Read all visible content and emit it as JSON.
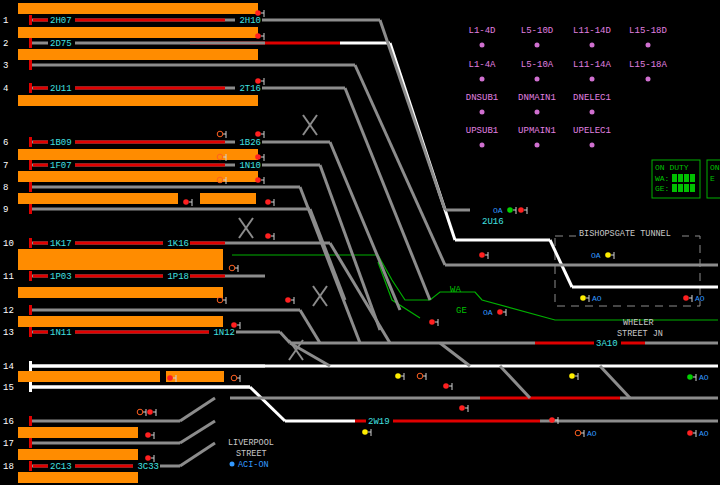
{
  "platforms": [
    {
      "number": "1",
      "track": "occupied",
      "berths": [
        "2H07",
        "2H10"
      ]
    },
    {
      "number": "2",
      "track": "clear",
      "berths": [
        "2D75"
      ]
    },
    {
      "number": "3",
      "track": "clear",
      "berths": []
    },
    {
      "number": "4",
      "track": "occupied",
      "berths": [
        "2U11",
        "2T16"
      ]
    },
    {
      "number": "6",
      "track": "occupied",
      "berths": [
        "1B09",
        "1B26"
      ]
    },
    {
      "number": "7",
      "track": "occupied",
      "berths": [
        "1F07",
        "1N10"
      ]
    },
    {
      "number": "8",
      "track": "clear",
      "berths": []
    },
    {
      "number": "9",
      "track": "clear",
      "berths": []
    },
    {
      "number": "10",
      "track": "occupied",
      "berths": [
        "1K17",
        "1K16"
      ]
    },
    {
      "number": "11",
      "track": "occupied",
      "berths": [
        "1P03",
        "1P18"
      ]
    },
    {
      "number": "12",
      "track": "clear",
      "berths": []
    },
    {
      "number": "13",
      "track": "occupied",
      "berths": [
        "1N11",
        "1N12"
      ]
    },
    {
      "number": "14",
      "track": "set",
      "berths": []
    },
    {
      "number": "15",
      "track": "set",
      "berths": []
    },
    {
      "number": "16",
      "track": "clear",
      "berths": []
    },
    {
      "number": "17",
      "track": "clear",
      "berths": []
    },
    {
      "number": "18",
      "track": "occupied",
      "berths": [
        "2C13",
        "3C33"
      ]
    }
  ],
  "tracks": [
    {
      "state": "set"
    },
    {
      "state": "set"
    },
    {
      "state": "set"
    },
    {
      "state": "set"
    },
    {
      "state": "set"
    },
    {
      "state": "set"
    },
    {
      "state": "set"
    },
    {
      "state": "set"
    },
    {
      "state": "set"
    },
    {
      "state": "occupied"
    },
    {
      "state": "occupied"
    },
    {
      "state": "occupied"
    },
    {
      "state": "occupied"
    },
    {
      "state": "clear"
    },
    {
      "state": "clear"
    },
    {
      "state": "clear"
    },
    {
      "state": "clear"
    },
    {
      "state": "clear"
    },
    {
      "state": "clear"
    },
    {
      "state": "clear"
    },
    {
      "state": "clear"
    },
    {
      "state": "clear"
    },
    {
      "state": "clear"
    },
    {
      "state": "clear"
    },
    {
      "state": "clear"
    },
    {
      "state": "clear"
    },
    {
      "state": "clear"
    },
    {
      "state": "clear"
    },
    {
      "state": "clear"
    },
    {
      "state": "clear"
    },
    {
      "state": "clear"
    },
    {
      "state": "clear"
    },
    {
      "state": "clear"
    },
    {
      "state": "clear"
    },
    {
      "state": "clear"
    },
    {
      "state": "clear"
    },
    {
      "state": "clear"
    },
    {
      "state": "clear"
    },
    {
      "state": "clear"
    },
    {
      "state": "clear"
    },
    {
      "state": "clear"
    },
    {
      "state": "clear"
    },
    {
      "state": "clear"
    },
    {
      "state": "clear"
    },
    {
      "state": "clear"
    },
    {
      "state": "clear"
    },
    {
      "state": "clear"
    },
    {
      "state": "clear"
    }
  ],
  "berths": [
    {
      "label": "2U16"
    },
    {
      "label": "3A10"
    },
    {
      "label": "2W19"
    }
  ],
  "signals": [
    {
      "aspect": "red"
    },
    {
      "aspect": "red"
    },
    {
      "aspect": "red"
    },
    {
      "aspect": "off"
    },
    {
      "aspect": "red"
    },
    {
      "aspect": "off"
    },
    {
      "aspect": "red"
    },
    {
      "aspect": "off"
    },
    {
      "aspect": "red"
    },
    {
      "aspect": "red"
    },
    {
      "aspect": "red"
    },
    {
      "aspect": "red"
    },
    {
      "aspect": "off"
    },
    {
      "aspect": "off"
    },
    {
      "aspect": "red"
    },
    {
      "aspect": "red"
    },
    {
      "aspect": "red"
    },
    {
      "aspect": "off"
    },
    {
      "aspect": "off"
    },
    {
      "aspect": "red"
    },
    {
      "aspect": "red"
    },
    {
      "aspect": "red"
    },
    {
      "aspect": "green",
      "label": "OA"
    },
    {
      "aspect": "red"
    },
    {
      "aspect": "red"
    },
    {
      "aspect": "yellow",
      "label": "OA"
    },
    {
      "aspect": "yellow",
      "label": "AO"
    },
    {
      "aspect": "red",
      "label": "AO"
    },
    {
      "aspect": "red",
      "label": "OA"
    },
    {
      "aspect": "red"
    },
    {
      "aspect": "yellow"
    },
    {
      "aspect": "off"
    },
    {
      "aspect": "red"
    },
    {
      "aspect": "yellow"
    },
    {
      "aspect": "green",
      "label": "AO"
    },
    {
      "aspect": "red"
    },
    {
      "aspect": "red"
    },
    {
      "aspect": "yellow"
    },
    {
      "aspect": "off",
      "label": "AO"
    },
    {
      "aspect": "red",
      "label": "AO"
    }
  ],
  "indicators": [
    {
      "label": "L1-4D"
    },
    {
      "label": "L5-10D"
    },
    {
      "label": "L11-14D"
    },
    {
      "label": "L15-18D"
    },
    {
      "label": "L1-4A"
    },
    {
      "label": "L5-10A"
    },
    {
      "label": "L11-14A"
    },
    {
      "label": "L15-18A"
    },
    {
      "label": "DNSUB1"
    },
    {
      "label": "DNMAIN1"
    },
    {
      "label": "DNELEC1"
    },
    {
      "label": "UPSUB1"
    },
    {
      "label": "UPMAIN1"
    },
    {
      "label": "UPELEC1"
    }
  ],
  "duty_panels": [
    {
      "title": "ON DUTY",
      "rows": [
        {
          "label": "WA:",
          "level": 1
        },
        {
          "label": "GE:",
          "level": 1
        }
      ]
    },
    {
      "title": "ON",
      "rows": [
        {
          "label": "E"
        }
      ]
    }
  ],
  "labels": {
    "tunnel": "BISHOPSGATE TUNNEL",
    "junction": [
      "WHELER",
      "STREET JN"
    ],
    "station": [
      "LIVERPOOL",
      "STREET"
    ],
    "aci": "ACI-ON",
    "wa": "WA",
    "ge": "GE"
  }
}
